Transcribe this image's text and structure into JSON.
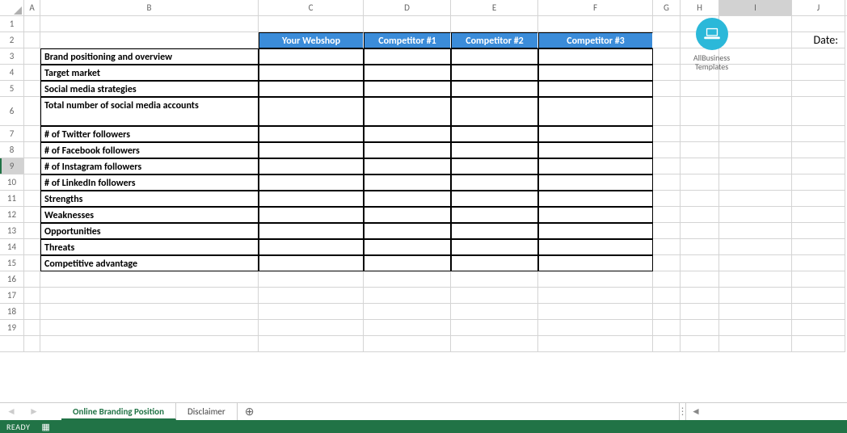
{
  "columns": [
    "A",
    "B",
    "C",
    "D",
    "E",
    "F",
    "G",
    "H",
    "I",
    "J"
  ],
  "selected_col": "I",
  "selected_row": 9,
  "headers": {
    "c": "Your Webshop",
    "d": "Competitor #1",
    "e": "Competitor #2",
    "f": "Competitor #3"
  },
  "rows": [
    "Brand positioning and overview",
    "Target market",
    "Social media strategies",
    "Total number of social media accounts",
    "# of Twitter followers",
    "# of Facebook followers",
    "# of Instagram followers",
    "# of LinkedIn followers",
    "Strengths",
    "Weaknesses",
    "Opportunities",
    "Threats",
    "Competitive advantage"
  ],
  "date_label": "Date:",
  "logo": {
    "line1": "AllBusiness",
    "line2": "Templates"
  },
  "tabs": {
    "active": "Online Branding Position",
    "other": "Disclaimer"
  },
  "status": "READY",
  "chart_data": {
    "type": "table",
    "title": "Online Branding Position",
    "columns": [
      "",
      "Your Webshop",
      "Competitor #1",
      "Competitor #2",
      "Competitor #3"
    ],
    "rows": [
      {
        "label": "Brand positioning and overview",
        "values": [
          "",
          "",
          "",
          ""
        ]
      },
      {
        "label": "Target market",
        "values": [
          "",
          "",
          "",
          ""
        ]
      },
      {
        "label": "Social media strategies",
        "values": [
          "",
          "",
          "",
          ""
        ]
      },
      {
        "label": "Total number of social media accounts",
        "values": [
          "",
          "",
          "",
          ""
        ]
      },
      {
        "label": "# of Twitter followers",
        "values": [
          "",
          "",
          "",
          ""
        ]
      },
      {
        "label": "# of Facebook followers",
        "values": [
          "",
          "",
          "",
          ""
        ]
      },
      {
        "label": "# of Instagram followers",
        "values": [
          "",
          "",
          "",
          ""
        ]
      },
      {
        "label": "# of LinkedIn followers",
        "values": [
          "",
          "",
          "",
          ""
        ]
      },
      {
        "label": "Strengths",
        "values": [
          "",
          "",
          "",
          ""
        ]
      },
      {
        "label": "Weaknesses",
        "values": [
          "",
          "",
          "",
          ""
        ]
      },
      {
        "label": "Opportunities",
        "values": [
          "",
          "",
          "",
          ""
        ]
      },
      {
        "label": "Threats",
        "values": [
          "",
          "",
          "",
          ""
        ]
      },
      {
        "label": "Competitive advantage",
        "values": [
          "",
          "",
          "",
          ""
        ]
      }
    ]
  }
}
